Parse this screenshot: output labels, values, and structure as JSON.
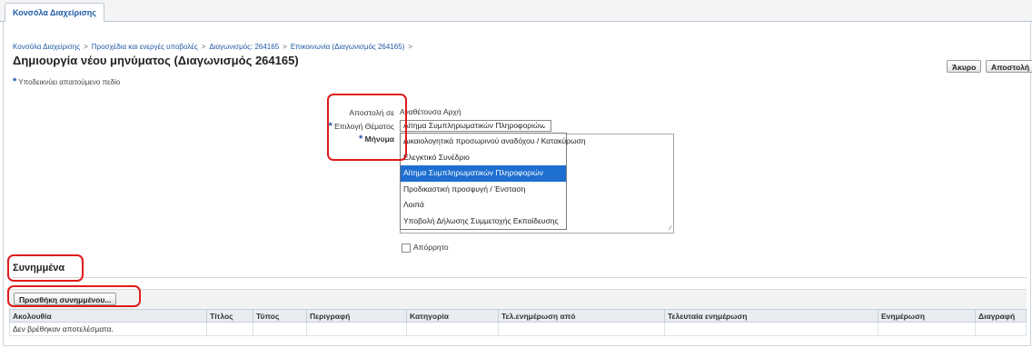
{
  "tabs": [
    "Κονσόλα Διαχείρισης"
  ],
  "breadcrumb": [
    "Κονσόλα Διαχείρισης",
    "Προσχέδια και ενεργές υποβολές",
    "Διαγωνισμός: 264165",
    "Επικοινωνία (Διαγωνισμός 264165)"
  ],
  "breadcrumb_sep": ">",
  "page_title": "Δημιουργία νέου μηνύματος (Διαγωνισμός 264165)",
  "buttons": {
    "cancel": "Άκυρο",
    "send": "Αποστολή"
  },
  "required_note": "Υποδεικνύει απαιτούμενο πεδίο",
  "required_marker": "*",
  "form": {
    "send_to_label": "Αποστολή σε",
    "send_to_value": "Αναθέτουσα Αρχή",
    "topic_label": "Επιλογή Θέματος",
    "topic_value": "Αίτημα Συμπληρωματικών Πληροφοριών",
    "message_label": "Μήνυμα",
    "topic_options": [
      "Δικαιολογητικά προσωρινού αναδόχου / Κατακύρωση",
      "Ελεγκτικό Συνέδριο",
      "Αίτημα Συμπληρωματικών Πληροφοριών",
      "Προδικαστική προσφυγή / Ένσταση",
      "Λοιπά",
      "Υποβολή Δήλωσης Συμμετοχής Εκπαίδευσης"
    ],
    "selected_option_index": 2,
    "confidential_label": "Απόρρητο",
    "confidential_checked": false
  },
  "attachments": {
    "title": "Συνημμένα",
    "add_button": "Προσθήκη συνημμένου...",
    "columns": [
      "Ακολουθία",
      "Τίτλος",
      "Τύπος",
      "Περιγραφή",
      "Κατηγορία",
      "Τελ.ενημέρωση από",
      "Τελευταία ενημέρωση",
      "Ενημέρωση",
      "Διαγραφή"
    ],
    "empty_message": "Δεν βρέθηκαν αποτελέσματα."
  },
  "colors": {
    "link": "#1f5aa6",
    "highlight": "#1e6fd0",
    "annotation": "#e01b1b",
    "required": "#1f5aa6"
  }
}
